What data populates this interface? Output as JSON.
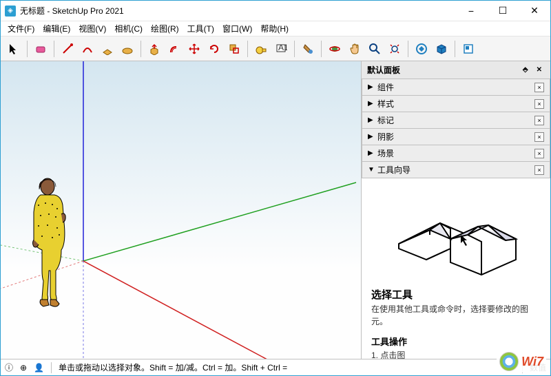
{
  "title": "无标题 - SketchUp Pro 2021",
  "menu": [
    "文件(F)",
    "编辑(E)",
    "视图(V)",
    "相机(C)",
    "绘图(R)",
    "工具(T)",
    "窗口(W)",
    "帮助(H)"
  ],
  "panels_title": "默认面板",
  "trays": [
    {
      "label": "组件",
      "open": false
    },
    {
      "label": "样式",
      "open": false
    },
    {
      "label": "标记",
      "open": false
    },
    {
      "label": "阴影",
      "open": false
    },
    {
      "label": "场景",
      "open": false
    },
    {
      "label": "工具向导",
      "open": true
    }
  ],
  "instructor": {
    "tool_title": "选择工具",
    "tool_desc": "在使用其他工具或命令时，选择要修改的图元。",
    "ops_title": "工具操作",
    "ops_line": "1. 点击图"
  },
  "status": {
    "hint": "单击或拖动以选择对象。Shift = 加/减。Ctrl = 加。Shift + Ctrl =",
    "measure_label": "数值"
  },
  "watermark": "Wi7"
}
